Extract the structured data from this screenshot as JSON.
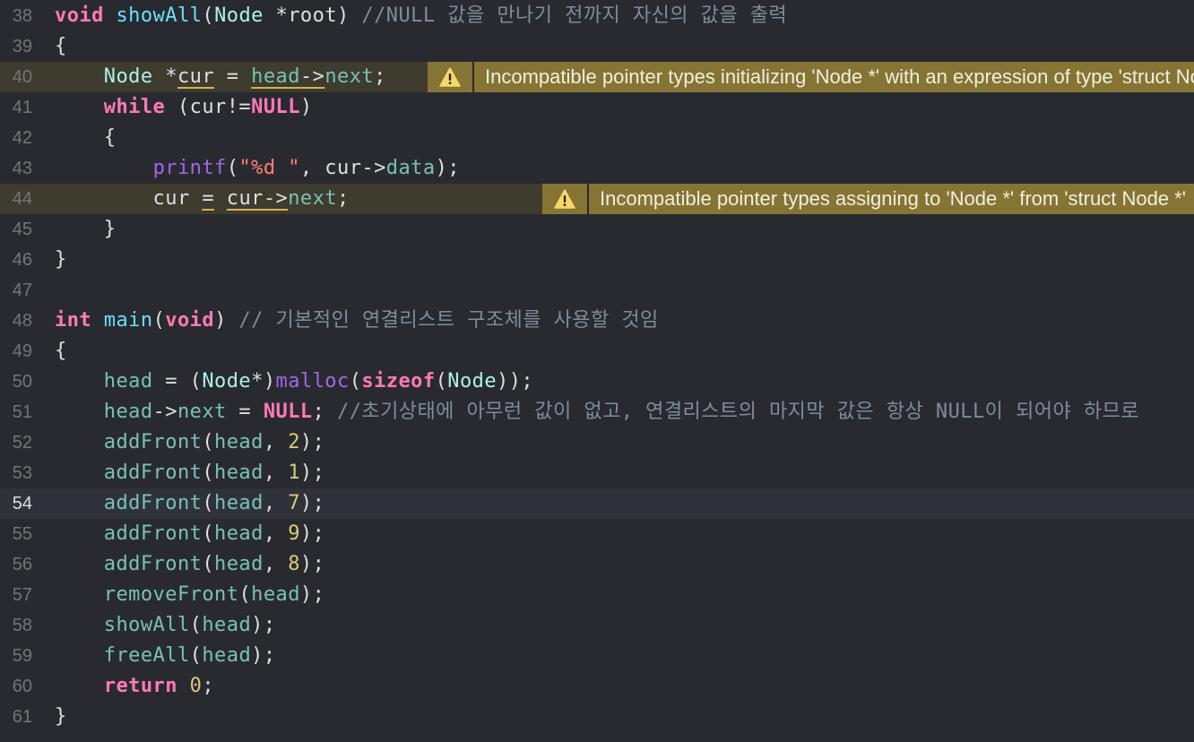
{
  "lines": [
    {
      "no": "38",
      "tokens": [
        {
          "t": "void",
          "c": "kw"
        },
        {
          "t": " "
        },
        {
          "t": "showAll",
          "c": "fn"
        },
        {
          "t": "("
        },
        {
          "t": "Node",
          "c": "ty2"
        },
        {
          "t": " *root) "
        },
        {
          "t": "//NULL 값을 만나기 전까지 자신의 값을 출력",
          "c": "cm"
        }
      ]
    },
    {
      "no": "39",
      "tokens": [
        {
          "t": "{"
        }
      ]
    },
    {
      "no": "40",
      "warn": true,
      "tokens": [
        {
          "t": "    "
        },
        {
          "t": "Node",
          "c": "ty2"
        },
        {
          "t": " *"
        },
        {
          "t": "cur",
          "u": true
        },
        {
          "t": " = "
        },
        {
          "t": "head",
          "c": "vr",
          "u": true
        },
        {
          "t": "->",
          "u": true
        },
        {
          "t": "next",
          "c": "vr"
        },
        {
          "t": ";"
        }
      ],
      "warning": {
        "text": "Incompatible pointer types initializing 'Node *' with an expression of type 'struct Node *'",
        "icon": "warning-triangle-icon"
      }
    },
    {
      "no": "41",
      "tokens": [
        {
          "t": "    "
        },
        {
          "t": "while",
          "c": "kw"
        },
        {
          "t": " (cur!="
        },
        {
          "t": "NULL",
          "c": "kw"
        },
        {
          "t": ")"
        }
      ]
    },
    {
      "no": "42",
      "tokens": [
        {
          "t": "    {"
        }
      ]
    },
    {
      "no": "43",
      "tokens": [
        {
          "t": "        "
        },
        {
          "t": "printf",
          "c": "mc"
        },
        {
          "t": "("
        },
        {
          "t": "\"%d \"",
          "c": "str"
        },
        {
          "t": ", cur->"
        },
        {
          "t": "data",
          "c": "vr"
        },
        {
          "t": ");"
        }
      ]
    },
    {
      "no": "44",
      "warn": true,
      "tokens": [
        {
          "t": "        cur "
        },
        {
          "t": "=",
          "u": true
        },
        {
          "t": " "
        },
        {
          "t": "cur->",
          "u": true
        },
        {
          "t": "next",
          "c": "vr"
        },
        {
          "t": ";"
        }
      ],
      "warning": {
        "text": "Incompatible pointer types assigning to 'Node *' from 'struct Node *'",
        "icon": "warning-triangle-icon"
      }
    },
    {
      "no": "45",
      "tokens": [
        {
          "t": "    }"
        }
      ]
    },
    {
      "no": "46",
      "tokens": [
        {
          "t": "}"
        }
      ]
    },
    {
      "no": "47",
      "tokens": []
    },
    {
      "no": "48",
      "tokens": [
        {
          "t": "int",
          "c": "kw"
        },
        {
          "t": " "
        },
        {
          "t": "main",
          "c": "fn"
        },
        {
          "t": "("
        },
        {
          "t": "void",
          "c": "kw"
        },
        {
          "t": ") "
        },
        {
          "t": "// 기본적인 연결리스트 구조체를 사용할 것임",
          "c": "cm"
        }
      ]
    },
    {
      "no": "49",
      "tokens": [
        {
          "t": "{"
        }
      ]
    },
    {
      "no": "50",
      "tokens": [
        {
          "t": "    "
        },
        {
          "t": "head",
          "c": "vr"
        },
        {
          "t": " = ("
        },
        {
          "t": "Node",
          "c": "ty2"
        },
        {
          "t": "*)"
        },
        {
          "t": "malloc",
          "c": "mc"
        },
        {
          "t": "("
        },
        {
          "t": "sizeof",
          "c": "kw"
        },
        {
          "t": "("
        },
        {
          "t": "Node",
          "c": "ty2"
        },
        {
          "t": "));"
        }
      ]
    },
    {
      "no": "51",
      "tokens": [
        {
          "t": "    "
        },
        {
          "t": "head",
          "c": "vr"
        },
        {
          "t": "->"
        },
        {
          "t": "next",
          "c": "vr"
        },
        {
          "t": " = "
        },
        {
          "t": "NULL",
          "c": "kw"
        },
        {
          "t": "; "
        },
        {
          "t": "//초기상태에 아무런 값이 없고, 연결리스트의 마지막 값은 항상 NULL이 되어야 하므로",
          "c": "cm"
        }
      ]
    },
    {
      "no": "52",
      "tokens": [
        {
          "t": "    "
        },
        {
          "t": "addFront",
          "c": "fn2"
        },
        {
          "t": "("
        },
        {
          "t": "head",
          "c": "vr"
        },
        {
          "t": ", "
        },
        {
          "t": "2",
          "c": "num"
        },
        {
          "t": ");"
        }
      ]
    },
    {
      "no": "53",
      "tokens": [
        {
          "t": "    "
        },
        {
          "t": "addFront",
          "c": "fn2"
        },
        {
          "t": "("
        },
        {
          "t": "head",
          "c": "vr"
        },
        {
          "t": ", "
        },
        {
          "t": "1",
          "c": "num"
        },
        {
          "t": ");"
        }
      ]
    },
    {
      "no": "54",
      "current": true,
      "tokens": [
        {
          "t": "    "
        },
        {
          "t": "addFront",
          "c": "fn2"
        },
        {
          "t": "("
        },
        {
          "t": "head",
          "c": "vr"
        },
        {
          "t": ", "
        },
        {
          "t": "7",
          "c": "num"
        },
        {
          "t": ");"
        }
      ]
    },
    {
      "no": "55",
      "tokens": [
        {
          "t": "    "
        },
        {
          "t": "addFront",
          "c": "fn2"
        },
        {
          "t": "("
        },
        {
          "t": "head",
          "c": "vr"
        },
        {
          "t": ", "
        },
        {
          "t": "9",
          "c": "num"
        },
        {
          "t": ");"
        }
      ]
    },
    {
      "no": "56",
      "tokens": [
        {
          "t": "    "
        },
        {
          "t": "addFront",
          "c": "fn2"
        },
        {
          "t": "("
        },
        {
          "t": "head",
          "c": "vr"
        },
        {
          "t": ", "
        },
        {
          "t": "8",
          "c": "num"
        },
        {
          "t": ");"
        }
      ]
    },
    {
      "no": "57",
      "tokens": [
        {
          "t": "    "
        },
        {
          "t": "removeFront",
          "c": "fn2"
        },
        {
          "t": "("
        },
        {
          "t": "head",
          "c": "vr"
        },
        {
          "t": ");"
        }
      ]
    },
    {
      "no": "58",
      "tokens": [
        {
          "t": "    "
        },
        {
          "t": "showAll",
          "c": "fn2"
        },
        {
          "t": "("
        },
        {
          "t": "head",
          "c": "vr"
        },
        {
          "t": ");"
        }
      ]
    },
    {
      "no": "59",
      "tokens": [
        {
          "t": "    "
        },
        {
          "t": "freeAll",
          "c": "fn2"
        },
        {
          "t": "("
        },
        {
          "t": "head",
          "c": "vr"
        },
        {
          "t": ");"
        }
      ]
    },
    {
      "no": "60",
      "tokens": [
        {
          "t": "    "
        },
        {
          "t": "return",
          "c": "kw"
        },
        {
          "t": " "
        },
        {
          "t": "0",
          "c": "num"
        },
        {
          "t": ";"
        }
      ]
    },
    {
      "no": "61",
      "tokens": [
        {
          "t": "}"
        }
      ]
    }
  ],
  "colors": {
    "background": "#292a30",
    "warning_line": "#3e3b2f",
    "warning_badge": "#857434",
    "current_line": "#2f3239",
    "keyword": "#ff7ab2",
    "comment": "#7f8c98",
    "number": "#d9c97c",
    "string": "#ff8170"
  }
}
